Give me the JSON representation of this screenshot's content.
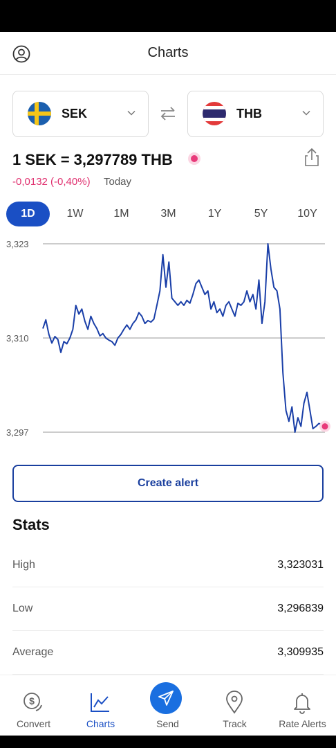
{
  "header": {
    "title": "Charts",
    "profile_icon": "user-circle-icon"
  },
  "converter": {
    "from": {
      "code": "SEK",
      "flag": "sweden-flag-icon"
    },
    "to": {
      "code": "THB",
      "flag": "thailand-flag-icon"
    },
    "swap_icon": "swap-arrows-icon"
  },
  "rate": {
    "text": "1 SEK = 3,297789 THB",
    "change": "-0,0132 (-0,40%)",
    "period": "Today",
    "change_color": "#e0306f"
  },
  "ranges": [
    {
      "label": "1D",
      "active": true
    },
    {
      "label": "1W",
      "active": false
    },
    {
      "label": "1M",
      "active": false
    },
    {
      "label": "3M",
      "active": false
    },
    {
      "label": "1Y",
      "active": false
    },
    {
      "label": "5Y",
      "active": false
    },
    {
      "label": "10Y",
      "active": false
    }
  ],
  "chart_data": {
    "type": "line",
    "yticks": [
      "3,323",
      "3,310",
      "3,297"
    ],
    "ylim": [
      3.297,
      3.323
    ],
    "grid": true,
    "series_color": "#1a3fa8",
    "series": [
      {
        "values": [
          3.3113,
          3.3125,
          3.3105,
          3.3093,
          3.3102,
          3.3098,
          3.308,
          3.3095,
          3.3092,
          3.31,
          3.3112,
          3.3145,
          3.3133,
          3.314,
          3.3123,
          3.3112,
          3.313,
          3.312,
          3.3113,
          3.3103,
          3.3106,
          3.31,
          3.3097,
          3.3095,
          3.309,
          3.31,
          3.3105,
          3.3112,
          3.3118,
          3.3112,
          3.312,
          3.3125,
          3.3135,
          3.313,
          3.312,
          3.3124,
          3.3122,
          3.3126,
          3.3145,
          3.3165,
          3.3215,
          3.317,
          3.3205,
          3.3155,
          3.315,
          3.3145,
          3.315,
          3.3145,
          3.3152,
          3.3148,
          3.316,
          3.3175,
          3.318,
          3.317,
          3.316,
          3.3165,
          3.314,
          3.315,
          3.3135,
          3.314,
          3.313,
          3.3145,
          3.315,
          3.314,
          3.313,
          3.3148,
          3.3145,
          3.315,
          3.3165,
          3.315,
          3.316,
          3.314,
          3.318,
          3.312,
          3.315,
          3.323,
          3.3195,
          3.317,
          3.3165,
          3.314,
          3.3052,
          3.3,
          3.2985,
          3.3005,
          3.297,
          3.299,
          3.2978,
          3.301,
          3.3025,
          3.3,
          3.2975,
          3.2978,
          3.2982,
          3.298,
          3.2978
        ]
      }
    ]
  },
  "create_alert": {
    "label": "Create alert"
  },
  "stats": {
    "title": "Stats",
    "rows": [
      {
        "label": "High",
        "value": "3,323031"
      },
      {
        "label": "Low",
        "value": "3,296839"
      },
      {
        "label": "Average",
        "value": "3,309935"
      }
    ]
  },
  "nav": [
    {
      "label": "Convert",
      "icon": "dollar-coins-icon",
      "active": false
    },
    {
      "label": "Charts",
      "icon": "line-chart-icon",
      "active": true
    },
    {
      "label": "Send",
      "icon": "paper-plane-icon",
      "active": false
    },
    {
      "label": "Track",
      "icon": "map-pin-icon",
      "active": false
    },
    {
      "label": "Rate Alerts",
      "icon": "bell-icon",
      "active": false
    }
  ]
}
